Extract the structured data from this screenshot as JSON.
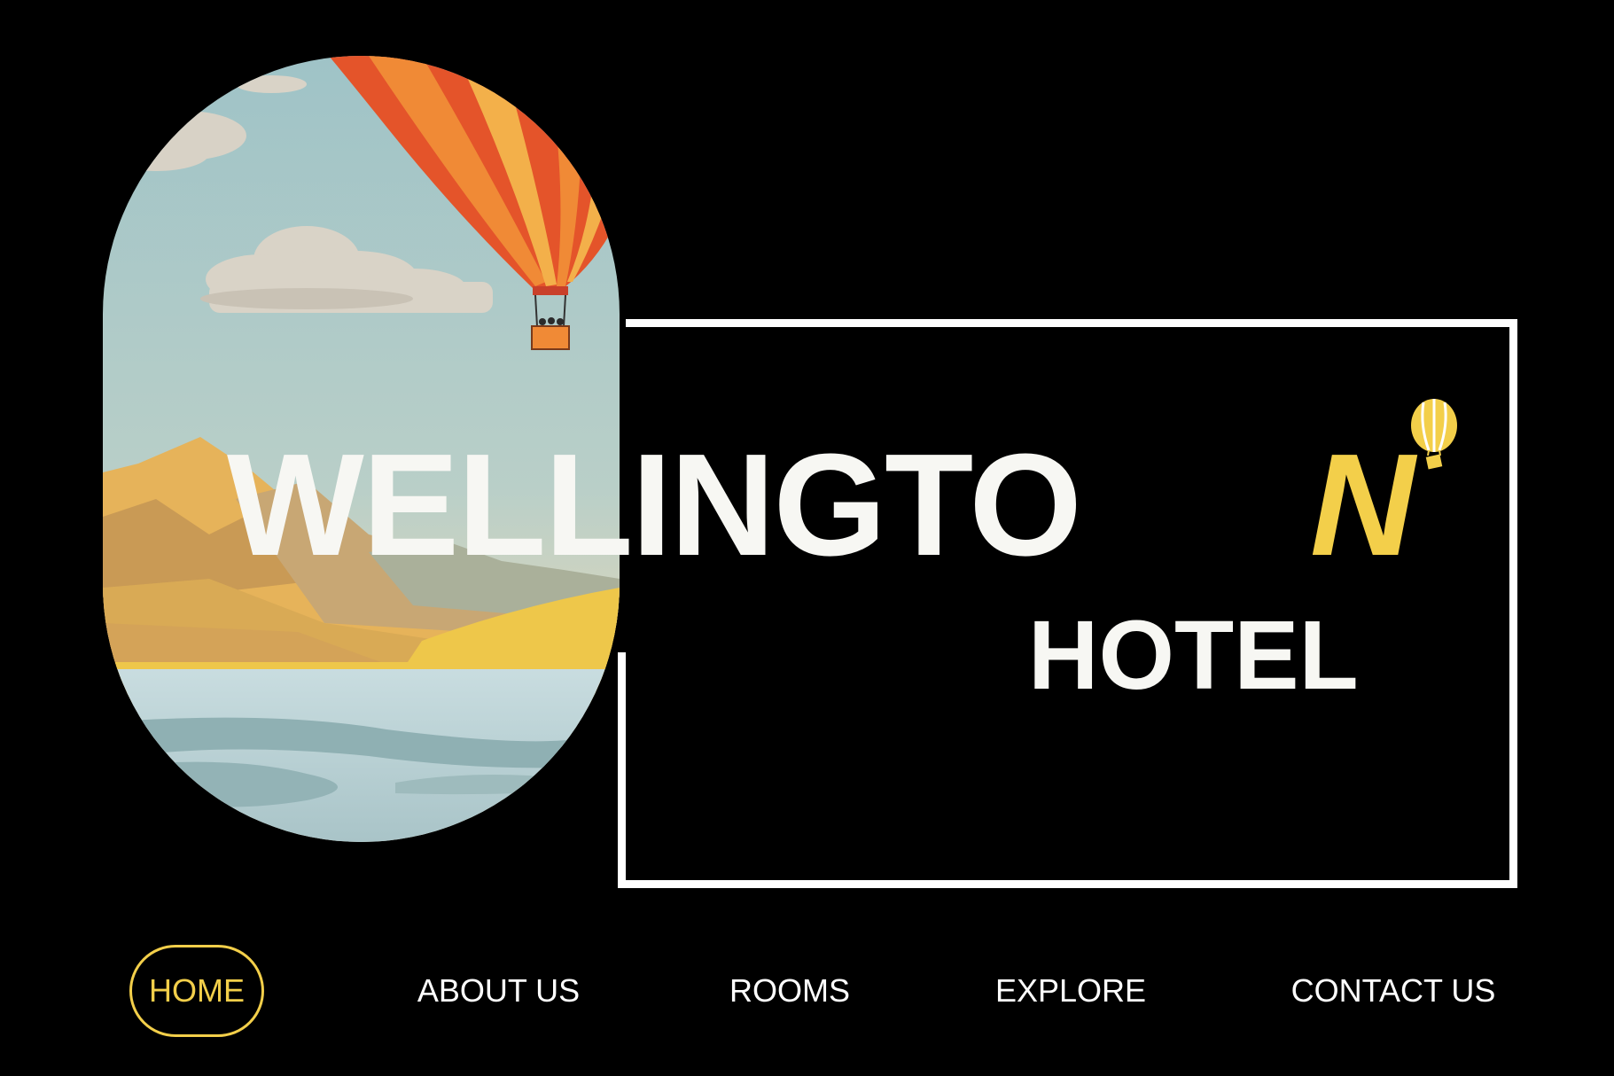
{
  "brand": {
    "name_main": "WELLINGTO",
    "name_last_letter": "N",
    "name_sub": "HOTEL",
    "logo_icon": "hot-air-balloon-icon",
    "accent_color": "#f3cf4a",
    "text_color": "#f7f7f3"
  },
  "hero": {
    "illustration": "hot-air-balloon-over-mountain-lake",
    "balloon_colors": [
      "#e4542a",
      "#f08a36",
      "#f3b04a"
    ]
  },
  "nav": {
    "items": [
      {
        "label": "HOME",
        "active": true
      },
      {
        "label": "ABOUT US",
        "active": false
      },
      {
        "label": "ROOMS",
        "active": false
      },
      {
        "label": "EXPLORE",
        "active": false
      },
      {
        "label": "CONTACT US",
        "active": false
      }
    ],
    "active_color": "#f3cf4a",
    "text_color": "#ffffff"
  },
  "page": {
    "background": "#000000"
  }
}
